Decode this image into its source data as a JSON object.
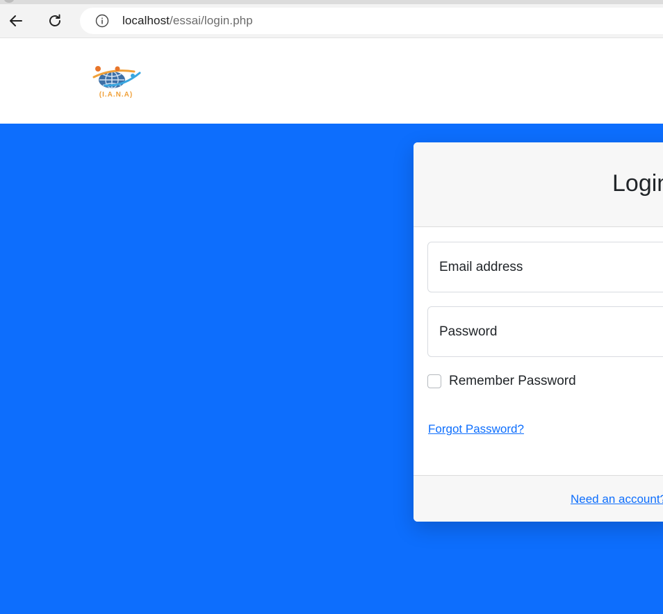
{
  "browser": {
    "url_host": "localhost",
    "url_path": "/essai/login.php"
  },
  "header": {
    "logo_text": "(I.A.N.A)"
  },
  "login_card": {
    "title": "Login",
    "email_placeholder": "Email address",
    "password_placeholder": "Password",
    "remember_label": "Remember Password",
    "forgot_link": "Forgot Password?",
    "signup_link": "Need an account? Sign up!"
  },
  "colors": {
    "primary": "#0d6efd",
    "card_header_bg": "#f7f7f7",
    "logo_orange": "#f0a13a",
    "logo_blue": "#3d6fa6"
  }
}
